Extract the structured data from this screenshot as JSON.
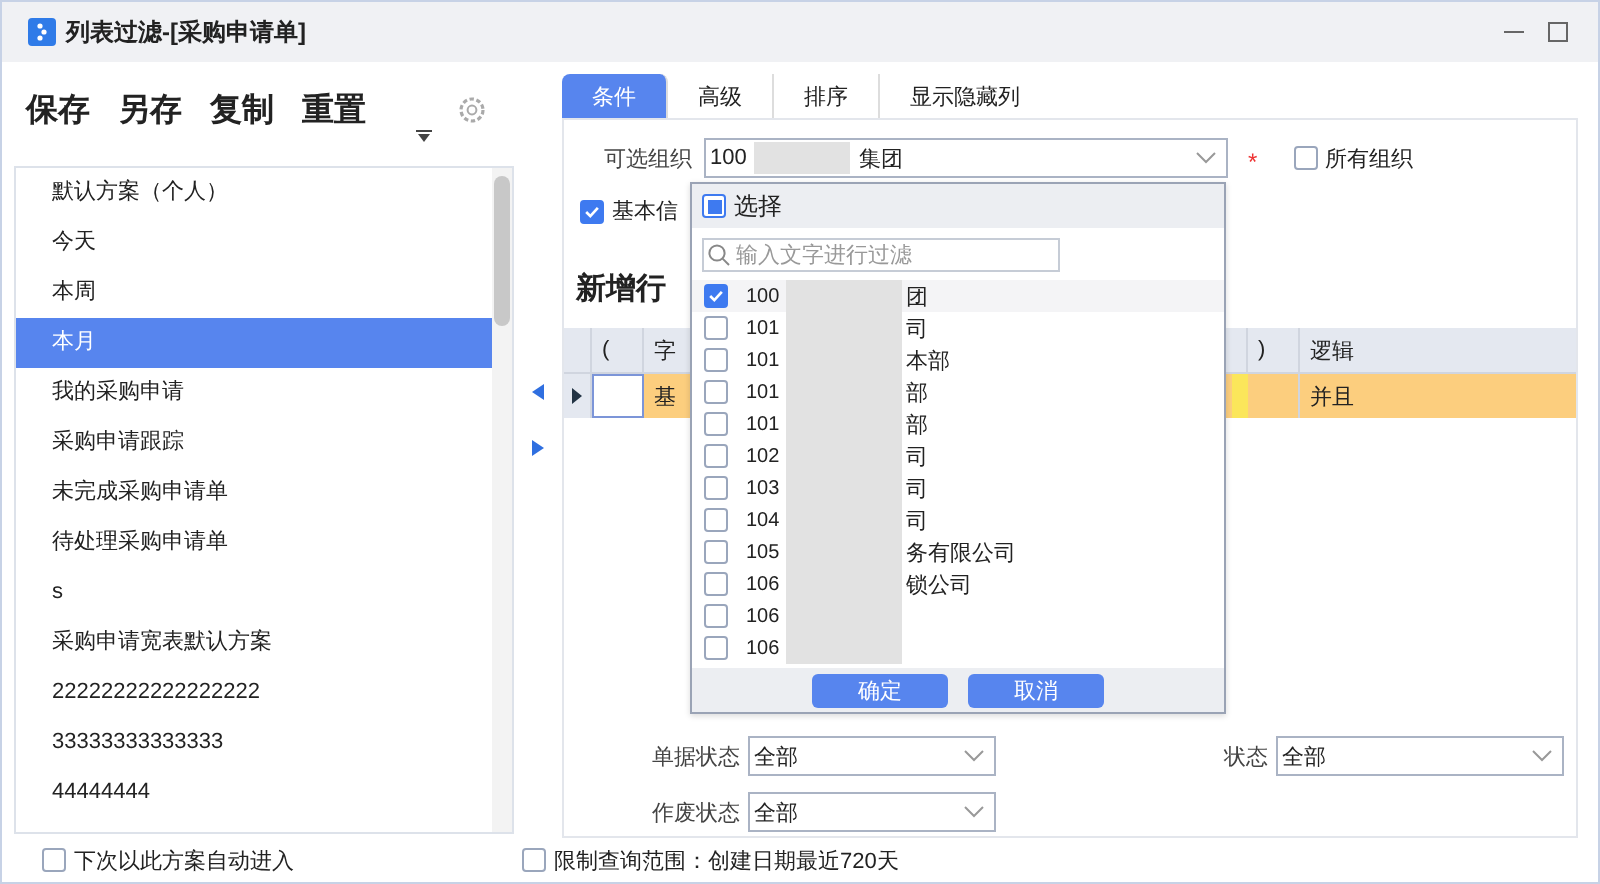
{
  "window": {
    "title": "列表过滤-[采购申请单]"
  },
  "toolbar": [
    "保存",
    "另存",
    "复制",
    "重置"
  ],
  "schemes": [
    {
      "label": "默认方案（个人）",
      "selected": false
    },
    {
      "label": "今天",
      "selected": false
    },
    {
      "label": "本周",
      "selected": false
    },
    {
      "label": "本月",
      "selected": true
    },
    {
      "label": "我的采购申请",
      "selected": false
    },
    {
      "label": "采购申请跟踪",
      "selected": false
    },
    {
      "label": "未完成采购申请单",
      "selected": false
    },
    {
      "label": "待处理采购申请单",
      "selected": false
    },
    {
      "label": "s",
      "selected": false
    },
    {
      "label": "采购申请宽表默认方案",
      "selected": false
    },
    {
      "label": "22222222222222222",
      "selected": false
    },
    {
      "label": "33333333333333",
      "selected": false
    },
    {
      "label": "44444444",
      "selected": false
    }
  ],
  "auto_enter": {
    "label": "下次以此方案自动进入",
    "checked": false
  },
  "tabs": [
    {
      "label": "条件",
      "selected": true
    },
    {
      "label": "高级",
      "selected": false
    },
    {
      "label": "排序",
      "selected": false
    },
    {
      "label": "显示隐藏列",
      "selected": false
    }
  ],
  "org": {
    "label": "可选组织",
    "value_prefix": "100",
    "value_suffix": "集团",
    "required_mark": "*"
  },
  "all_orgs": {
    "label": "所有组织",
    "checked": false
  },
  "basic_info": {
    "label": "基本信",
    "checked": true
  },
  "new_row": "新增行",
  "table": {
    "columns": [
      "(",
      "字",
      ")",
      "逻辑"
    ],
    "rows": [
      {
        "cells": [
          "",
          "基",
          "",
          "并且"
        ],
        "selected": true
      }
    ]
  },
  "org_popup": {
    "select_all": {
      "label": "选择",
      "partial": true
    },
    "filter_placeholder": "输入文字进行过滤",
    "items": [
      {
        "code": "100",
        "suffix": "团",
        "checked": true
      },
      {
        "code": "101",
        "suffix": "司",
        "checked": false
      },
      {
        "code": "101",
        "suffix": "本部",
        "checked": false
      },
      {
        "code": "101",
        "suffix": "部",
        "checked": false
      },
      {
        "code": "101",
        "suffix": "部",
        "checked": false
      },
      {
        "code": "102",
        "suffix": "司",
        "checked": false
      },
      {
        "code": "103",
        "suffix": "司",
        "checked": false
      },
      {
        "code": "104",
        "suffix": "司",
        "checked": false
      },
      {
        "code": "105",
        "suffix": "务有限公司",
        "checked": false
      },
      {
        "code": "106",
        "suffix": "锁公司",
        "checked": false
      },
      {
        "code": "106",
        "checked": false
      },
      {
        "code": "106",
        "checked": false
      }
    ],
    "buttons": [
      "确定",
      "取消"
    ]
  },
  "fields": [
    {
      "label": "单据状态",
      "value": "全部"
    },
    {
      "label": "状态",
      "value": "全部"
    },
    {
      "label": "作废状态",
      "value": "全部"
    }
  ],
  "limit": {
    "label": "限制查询范围：创建日期最近720天",
    "checked": false
  }
}
